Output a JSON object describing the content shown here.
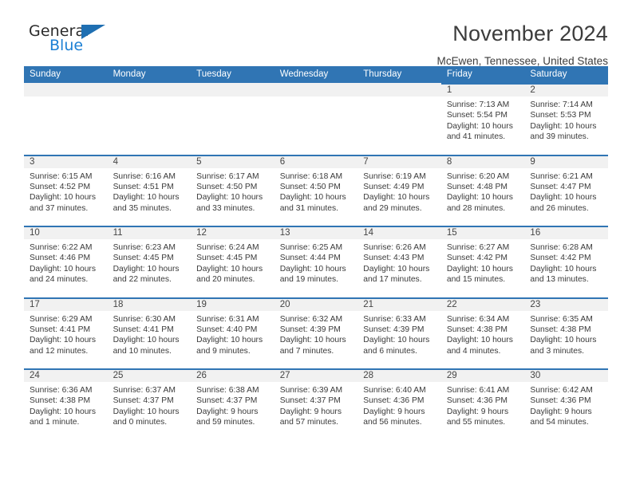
{
  "brand": {
    "name_part1": "General",
    "name_part2": "Blue",
    "triangle_color": "#1f6fb2",
    "blue_text_color": "#1b7fd4"
  },
  "header": {
    "title": "November 2024",
    "location": "McEwen, Tennessee, United States",
    "accent_color": "#3075b4",
    "daynum_strip_color": "#f1f1f1"
  },
  "calendar": {
    "weekdays": [
      "Sunday",
      "Monday",
      "Tuesday",
      "Wednesday",
      "Thursday",
      "Friday",
      "Saturday"
    ],
    "weeks": [
      [
        {
          "empty": true
        },
        {
          "empty": true
        },
        {
          "empty": true
        },
        {
          "empty": true
        },
        {
          "empty": true
        },
        {
          "day": "1",
          "sunrise": "Sunrise: 7:13 AM",
          "sunset": "Sunset: 5:54 PM",
          "daylight_line1": "Daylight: 10 hours",
          "daylight_line2": "and 41 minutes."
        },
        {
          "day": "2",
          "sunrise": "Sunrise: 7:14 AM",
          "sunset": "Sunset: 5:53 PM",
          "daylight_line1": "Daylight: 10 hours",
          "daylight_line2": "and 39 minutes."
        }
      ],
      [
        {
          "day": "3",
          "sunrise": "Sunrise: 6:15 AM",
          "sunset": "Sunset: 4:52 PM",
          "daylight_line1": "Daylight: 10 hours",
          "daylight_line2": "and 37 minutes."
        },
        {
          "day": "4",
          "sunrise": "Sunrise: 6:16 AM",
          "sunset": "Sunset: 4:51 PM",
          "daylight_line1": "Daylight: 10 hours",
          "daylight_line2": "and 35 minutes."
        },
        {
          "day": "5",
          "sunrise": "Sunrise: 6:17 AM",
          "sunset": "Sunset: 4:50 PM",
          "daylight_line1": "Daylight: 10 hours",
          "daylight_line2": "and 33 minutes."
        },
        {
          "day": "6",
          "sunrise": "Sunrise: 6:18 AM",
          "sunset": "Sunset: 4:50 PM",
          "daylight_line1": "Daylight: 10 hours",
          "daylight_line2": "and 31 minutes."
        },
        {
          "day": "7",
          "sunrise": "Sunrise: 6:19 AM",
          "sunset": "Sunset: 4:49 PM",
          "daylight_line1": "Daylight: 10 hours",
          "daylight_line2": "and 29 minutes."
        },
        {
          "day": "8",
          "sunrise": "Sunrise: 6:20 AM",
          "sunset": "Sunset: 4:48 PM",
          "daylight_line1": "Daylight: 10 hours",
          "daylight_line2": "and 28 minutes."
        },
        {
          "day": "9",
          "sunrise": "Sunrise: 6:21 AM",
          "sunset": "Sunset: 4:47 PM",
          "daylight_line1": "Daylight: 10 hours",
          "daylight_line2": "and 26 minutes."
        }
      ],
      [
        {
          "day": "10",
          "sunrise": "Sunrise: 6:22 AM",
          "sunset": "Sunset: 4:46 PM",
          "daylight_line1": "Daylight: 10 hours",
          "daylight_line2": "and 24 minutes."
        },
        {
          "day": "11",
          "sunrise": "Sunrise: 6:23 AM",
          "sunset": "Sunset: 4:45 PM",
          "daylight_line1": "Daylight: 10 hours",
          "daylight_line2": "and 22 minutes."
        },
        {
          "day": "12",
          "sunrise": "Sunrise: 6:24 AM",
          "sunset": "Sunset: 4:45 PM",
          "daylight_line1": "Daylight: 10 hours",
          "daylight_line2": "and 20 minutes."
        },
        {
          "day": "13",
          "sunrise": "Sunrise: 6:25 AM",
          "sunset": "Sunset: 4:44 PM",
          "daylight_line1": "Daylight: 10 hours",
          "daylight_line2": "and 19 minutes."
        },
        {
          "day": "14",
          "sunrise": "Sunrise: 6:26 AM",
          "sunset": "Sunset: 4:43 PM",
          "daylight_line1": "Daylight: 10 hours",
          "daylight_line2": "and 17 minutes."
        },
        {
          "day": "15",
          "sunrise": "Sunrise: 6:27 AM",
          "sunset": "Sunset: 4:42 PM",
          "daylight_line1": "Daylight: 10 hours",
          "daylight_line2": "and 15 minutes."
        },
        {
          "day": "16",
          "sunrise": "Sunrise: 6:28 AM",
          "sunset": "Sunset: 4:42 PM",
          "daylight_line1": "Daylight: 10 hours",
          "daylight_line2": "and 13 minutes."
        }
      ],
      [
        {
          "day": "17",
          "sunrise": "Sunrise: 6:29 AM",
          "sunset": "Sunset: 4:41 PM",
          "daylight_line1": "Daylight: 10 hours",
          "daylight_line2": "and 12 minutes."
        },
        {
          "day": "18",
          "sunrise": "Sunrise: 6:30 AM",
          "sunset": "Sunset: 4:41 PM",
          "daylight_line1": "Daylight: 10 hours",
          "daylight_line2": "and 10 minutes."
        },
        {
          "day": "19",
          "sunrise": "Sunrise: 6:31 AM",
          "sunset": "Sunset: 4:40 PM",
          "daylight_line1": "Daylight: 10 hours",
          "daylight_line2": "and 9 minutes."
        },
        {
          "day": "20",
          "sunrise": "Sunrise: 6:32 AM",
          "sunset": "Sunset: 4:39 PM",
          "daylight_line1": "Daylight: 10 hours",
          "daylight_line2": "and 7 minutes."
        },
        {
          "day": "21",
          "sunrise": "Sunrise: 6:33 AM",
          "sunset": "Sunset: 4:39 PM",
          "daylight_line1": "Daylight: 10 hours",
          "daylight_line2": "and 6 minutes."
        },
        {
          "day": "22",
          "sunrise": "Sunrise: 6:34 AM",
          "sunset": "Sunset: 4:38 PM",
          "daylight_line1": "Daylight: 10 hours",
          "daylight_line2": "and 4 minutes."
        },
        {
          "day": "23",
          "sunrise": "Sunrise: 6:35 AM",
          "sunset": "Sunset: 4:38 PM",
          "daylight_line1": "Daylight: 10 hours",
          "daylight_line2": "and 3 minutes."
        }
      ],
      [
        {
          "day": "24",
          "sunrise": "Sunrise: 6:36 AM",
          "sunset": "Sunset: 4:38 PM",
          "daylight_line1": "Daylight: 10 hours",
          "daylight_line2": "and 1 minute."
        },
        {
          "day": "25",
          "sunrise": "Sunrise: 6:37 AM",
          "sunset": "Sunset: 4:37 PM",
          "daylight_line1": "Daylight: 10 hours",
          "daylight_line2": "and 0 minutes."
        },
        {
          "day": "26",
          "sunrise": "Sunrise: 6:38 AM",
          "sunset": "Sunset: 4:37 PM",
          "daylight_line1": "Daylight: 9 hours",
          "daylight_line2": "and 59 minutes."
        },
        {
          "day": "27",
          "sunrise": "Sunrise: 6:39 AM",
          "sunset": "Sunset: 4:37 PM",
          "daylight_line1": "Daylight: 9 hours",
          "daylight_line2": "and 57 minutes."
        },
        {
          "day": "28",
          "sunrise": "Sunrise: 6:40 AM",
          "sunset": "Sunset: 4:36 PM",
          "daylight_line1": "Daylight: 9 hours",
          "daylight_line2": "and 56 minutes."
        },
        {
          "day": "29",
          "sunrise": "Sunrise: 6:41 AM",
          "sunset": "Sunset: 4:36 PM",
          "daylight_line1": "Daylight: 9 hours",
          "daylight_line2": "and 55 minutes."
        },
        {
          "day": "30",
          "sunrise": "Sunrise: 6:42 AM",
          "sunset": "Sunset: 4:36 PM",
          "daylight_line1": "Daylight: 9 hours",
          "daylight_line2": "and 54 minutes."
        }
      ]
    ]
  }
}
